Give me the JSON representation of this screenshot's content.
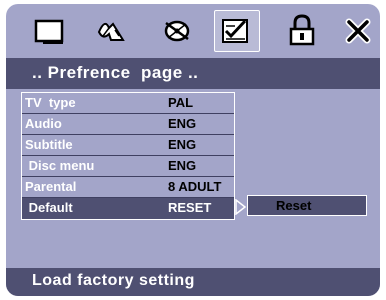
{
  "header": {
    "tabs": [
      {
        "icon": "tv-icon",
        "selected": false
      },
      {
        "icon": "audio-speaker-icon",
        "selected": false
      },
      {
        "icon": "video-disc-icon",
        "selected": false
      },
      {
        "icon": "preference-checklist-icon",
        "selected": true
      },
      {
        "icon": "lock-icon",
        "selected": false
      },
      {
        "icon": "close-icon",
        "selected": false
      }
    ]
  },
  "page": {
    "title": ".. Prefrence  page .."
  },
  "menu": {
    "items": [
      {
        "label": "TV  type",
        "value": "PAL"
      },
      {
        "label": "Audio",
        "value": "ENG"
      },
      {
        "label": "Subtitle",
        "value": "ENG"
      },
      {
        "label": " Disc menu",
        "value": "ENG"
      },
      {
        "label": "Parental",
        "value": "8 ADULT"
      },
      {
        "label": " Default",
        "value": "RESET",
        "selected": true
      }
    ]
  },
  "submenu": {
    "options": [
      "Reset"
    ]
  },
  "status": {
    "text": "Load factory setting"
  },
  "colors": {
    "background": "#a3a5c9",
    "bar": "#4f5072",
    "active_tab": "#b9bbd6"
  }
}
